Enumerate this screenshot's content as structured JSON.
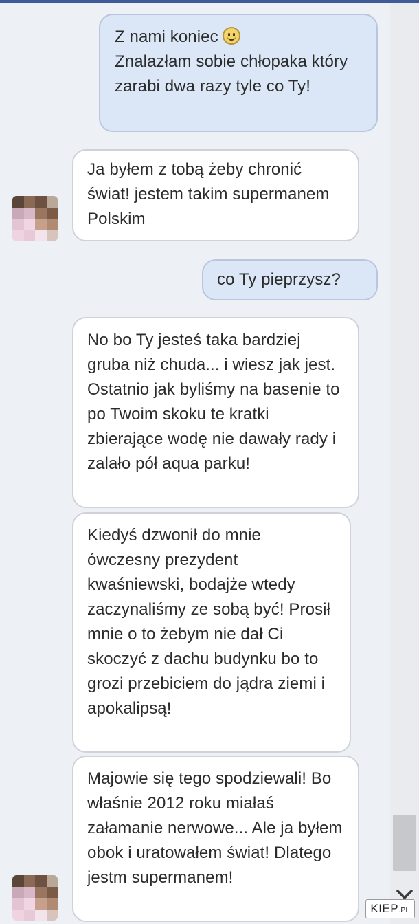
{
  "messages": [
    {
      "dir": "out",
      "text": "Z nami koniec",
      "has_emoji": true,
      "emoji": "smiley-icon",
      "text2": "Znalazłam sobie chłopaka który zarabi dwa razy tyle co Ty!"
    },
    {
      "dir": "in",
      "text": "Ja byłem z tobą żeby chronić świat! jestem takim supermanem Polskim"
    },
    {
      "dir": "out",
      "text": "co Ty pieprzysz?"
    },
    {
      "dir": "in",
      "text": "No bo Ty jesteś taka bardziej gruba niż chuda... i wiesz jak jest. Ostatnio jak byliśmy na basenie to po Twoim skoku te kratki zbierające wodę nie dawały rady i zalało pół aqua parku!"
    },
    {
      "dir": "in",
      "text": "Kiedyś dzwonił do mnie ówczesny prezydent kwaśniewski, bodajże wtedy zaczynaliśmy ze sobą być! Prosił mnie o to żebym nie dał Ci skoczyć z dachu budynku bo to grozi przebiciem do jądra ziemi i apokalipsą!"
    },
    {
      "dir": "in",
      "text": "Majowie się tego spodziewali! Bo właśnie 2012 roku miałaś załamanie nerwowe... Ale ja byłem obok i uratowałem świat! Dlatego jestm supermanem!"
    }
  ],
  "colors": {
    "outgoing_bubble": "#dbe7f7",
    "incoming_bubble": "#ffffff",
    "background": "#edf0f5",
    "header_bar": "#3f5b97"
  },
  "icons": {
    "scroll_down": "chevron-down-icon",
    "avatar": "pixelated-avatar"
  },
  "watermark": {
    "brand": "KIEP",
    "suffix": ".PL"
  }
}
